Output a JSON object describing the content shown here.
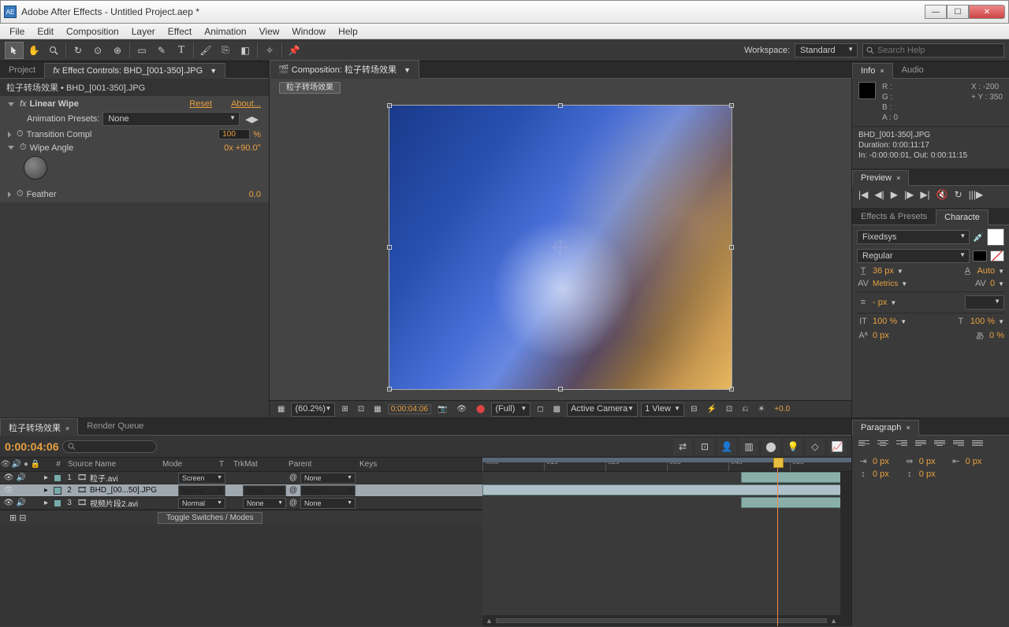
{
  "window": {
    "title": "Adobe After Effects - Untitled Project.aep *",
    "app_icon": "AE"
  },
  "menubar": [
    "File",
    "Edit",
    "Composition",
    "Layer",
    "Effect",
    "Animation",
    "View",
    "Window",
    "Help"
  ],
  "toolbar": {
    "workspace_label": "Workspace:",
    "workspace_value": "Standard",
    "search_placeholder": "Search Help"
  },
  "left": {
    "tab_project": "Project",
    "tab_ec": "Effect Controls: BHD_[001-350].JPG",
    "header": "粒子转场效果 • BHD_[001-350].JPG",
    "effect_name": "Linear Wipe",
    "reset": "Reset",
    "about": "About...",
    "ap_label": "Animation Presets:",
    "ap_value": "None",
    "tc_label": "Transition Compl",
    "tc_value": "100",
    "tc_unit": "%",
    "wa_label": "Wipe Angle",
    "wa_value": "0x +90.0°",
    "feather_label": "Feather",
    "feather_value": "0.0"
  },
  "comp": {
    "tab": "Composition: 粒子转场效果",
    "flow": "粒子转场效果"
  },
  "viewer_footer": {
    "zoom": "(60.2%)",
    "timecode": "0:00:04:06",
    "res": "(Full)",
    "camera": "Active Camera",
    "views": "1 View",
    "exposure": "+0.0"
  },
  "right": {
    "info_tab": "Info",
    "audio_tab": "Audio",
    "info": {
      "r": "R :",
      "g": "G :",
      "b": "B :",
      "a": "A : 0",
      "x": "X : -200",
      "y": "Y : 350",
      "file": "BHD_[001-350].JPG",
      "duration": "Duration: 0:00:11:17",
      "inout": "In: -0:00:00:01, Out: 0:00:11:15"
    },
    "preview_tab": "Preview",
    "ep_tab": "Effects & Presets",
    "char_tab": "Characte",
    "char": {
      "font": "Fixedsys",
      "style": "Regular",
      "size": "36 px",
      "leading": "Auto",
      "kerning": "Metrics",
      "tracking": "0",
      "stroke": "- px",
      "vscale": "100 %",
      "hscale": "100 %",
      "baseline": "0 px",
      "tsume": "0 %"
    }
  },
  "timeline": {
    "tab_comp": "粒子转场效果",
    "tab_rq": "Render Queue",
    "timecode": "0:00:04:06",
    "cols": {
      "num": "#",
      "source": "Source Name",
      "mode": "Mode",
      "t": "T",
      "trkmat": "TrkMat",
      "parent": "Parent",
      "keys": "Keys"
    },
    "layers": [
      {
        "num": "1",
        "name": "粒子.avi",
        "mode": "Screen",
        "trkmat": "",
        "parent": "None",
        "sel": false,
        "audio": true
      },
      {
        "num": "2",
        "name": "BHD_[00...50].JPG",
        "mode": "Normal",
        "trkmat": "None",
        "parent": "None",
        "sel": true,
        "audio": false
      },
      {
        "num": "3",
        "name": "视频片段2.avi",
        "mode": "Normal",
        "trkmat": "None",
        "parent": "None",
        "sel": false,
        "audio": true
      }
    ],
    "ruler": [
      ":00s",
      "01s",
      "02s",
      "03s",
      "04s",
      "05s"
    ],
    "toggle": "Toggle Switches / Modes"
  },
  "paragraph": {
    "tab": "Paragraph",
    "indent_l": "0 px",
    "indent_r": "0 px",
    "indent_fl": "0 px",
    "space_b": "0 px",
    "space_a": "0 px"
  }
}
